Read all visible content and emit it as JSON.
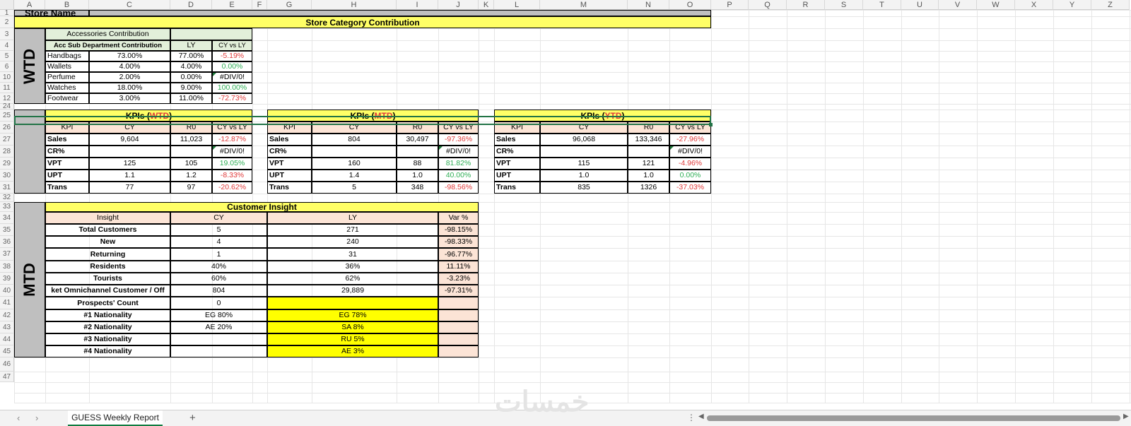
{
  "columns": [
    "A",
    "B",
    "C",
    "D",
    "E",
    "F",
    "G",
    "H",
    "I",
    "J",
    "K",
    "L",
    "M",
    "N",
    "O",
    "P",
    "Q",
    "R",
    "S",
    "T",
    "U",
    "V",
    "W",
    "X",
    "Y",
    "Z"
  ],
  "rows": [
    "1",
    "2",
    "3",
    "4",
    "5",
    "6",
    "10",
    "11",
    "12",
    "24",
    "25",
    "26",
    "27",
    "28",
    "29",
    "30",
    "31",
    "32",
    "33",
    "34",
    "35",
    "36",
    "37",
    "38",
    "39",
    "40",
    "41",
    "42",
    "43",
    "44",
    "45",
    "46",
    "47"
  ],
  "store_name_label": "Store Name",
  "banner_title": "Store Category Contribution",
  "wtd_label": "WTD",
  "mtd_label": "MTD",
  "acc": {
    "title": "Accessories Contribution",
    "headers": [
      "Acc Sub Department Contribution",
      "LY",
      "CY vs LY"
    ],
    "rows": [
      {
        "name": "Handbags",
        "cy": "73.00%",
        "ly": "77.00%",
        "var": "-5.19%"
      },
      {
        "name": "Wallets",
        "cy": "4.00%",
        "ly": "4.00%",
        "var": "0.00%"
      },
      {
        "name": "Perfume",
        "cy": "2.00%",
        "ly": "0.00%",
        "var": "#DIV/0!"
      },
      {
        "name": "Watches",
        "cy": "18.00%",
        "ly": "9.00%",
        "var": "100.00%"
      },
      {
        "name": "Footwear",
        "cy": "3.00%",
        "ly": "11.00%",
        "var": "-72.73%"
      }
    ]
  },
  "kpi_blocks": [
    {
      "title_prefix": "KPIs (",
      "period": "WTD",
      "title_suffix": ")",
      "headers": [
        "KPI",
        "CY",
        "R0",
        "CY vs LY"
      ],
      "rows": [
        {
          "kpi": "Sales",
          "cy": "9,604",
          "r0": "11,023",
          "var": "-12.87%"
        },
        {
          "kpi": "CR%",
          "cy": "",
          "r0": "",
          "var": "#DIV/0!"
        },
        {
          "kpi": "VPT",
          "cy": "125",
          "r0": "105",
          "var": "19.05%"
        },
        {
          "kpi": "UPT",
          "cy": "1.1",
          "r0": "1.2",
          "var": "-8.33%"
        },
        {
          "kpi": "Trans",
          "cy": "77",
          "r0": "97",
          "var": "-20.62%"
        }
      ]
    },
    {
      "title_prefix": "KPIs (",
      "period": "MTD",
      "title_suffix": ")",
      "headers": [
        "KPI",
        "CY",
        "R0",
        "CY vs LY"
      ],
      "rows": [
        {
          "kpi": "Sales",
          "cy": "804",
          "r0": "30,497",
          "var": "-97.36%"
        },
        {
          "kpi": "CR%",
          "cy": "",
          "r0": "",
          "var": "#DIV/0!"
        },
        {
          "kpi": "VPT",
          "cy": "160",
          "r0": "88",
          "var": "81.82%"
        },
        {
          "kpi": "UPT",
          "cy": "1.4",
          "r0": "1.0",
          "var": "40.00%"
        },
        {
          "kpi": "Trans",
          "cy": "5",
          "r0": "348",
          "var": "-98.56%"
        }
      ]
    },
    {
      "title_prefix": "KPIs (",
      "period": "YTD",
      "title_suffix": ")",
      "headers": [
        "KPI",
        "CY",
        "R0",
        "CY vs LY"
      ],
      "rows": [
        {
          "kpi": "Sales",
          "cy": "96,068",
          "r0": "133,346",
          "var": "-27.96%"
        },
        {
          "kpi": "CR%",
          "cy": "",
          "r0": "",
          "var": "#DIV/0!"
        },
        {
          "kpi": "VPT",
          "cy": "115",
          "r0": "121",
          "var": "-4.96%"
        },
        {
          "kpi": "UPT",
          "cy": "1.0",
          "r0": "1.0",
          "var": "0.00%"
        },
        {
          "kpi": "Trans",
          "cy": "835",
          "r0": "1326",
          "var": "-37.03%"
        }
      ]
    }
  ],
  "insight": {
    "title": "Customer Insight",
    "headers": [
      "Insight",
      "CY",
      "LY",
      "Var %"
    ],
    "rows": [
      {
        "name": "Total Customers",
        "cy": "5",
        "ly": "271",
        "var": "-98.15%"
      },
      {
        "name": "New",
        "cy": "4",
        "ly": "240",
        "var": "-98.33%"
      },
      {
        "name": "Returning",
        "cy": "1",
        "ly": "31",
        "var": "-96.77%"
      },
      {
        "name": "Residents",
        "cy": "40%",
        "ly": "36%",
        "var": "11.11%"
      },
      {
        "name": "Tourists",
        "cy": "60%",
        "ly": "62%",
        "var": "-3.23%"
      },
      {
        "name": "ket Omnichannel Customer / Off",
        "cy": "804",
        "ly": "29,889",
        "var": "-97.31%"
      },
      {
        "name": "Prospects' Count",
        "cy": "0",
        "ly": "",
        "var": ""
      },
      {
        "name": "#1 Nationality",
        "cy": "EG 80%",
        "ly": "EG 78%",
        "var": ""
      },
      {
        "name": "#2 Nationality",
        "cy": "AE 20%",
        "ly": "SA 8%",
        "var": ""
      },
      {
        "name": "#3 Nationality",
        "cy": "",
        "ly": "RU 5%",
        "var": ""
      },
      {
        "name": "#4 Nationality",
        "cy": "",
        "ly": "AE 3%",
        "var": ""
      }
    ]
  },
  "sheet_tab": "GUESS Weekly Report",
  "tab_nav": {
    "prev": "‹",
    "next": "›",
    "add": "+"
  },
  "colors": {
    "yellow": "#ffff66",
    "green_header": "#e2efda",
    "peach": "#fce4d6",
    "gray": "#bfbfbf",
    "negative": "#e03a3a",
    "positive": "#2fae55",
    "period_red": "#e03a3a"
  }
}
